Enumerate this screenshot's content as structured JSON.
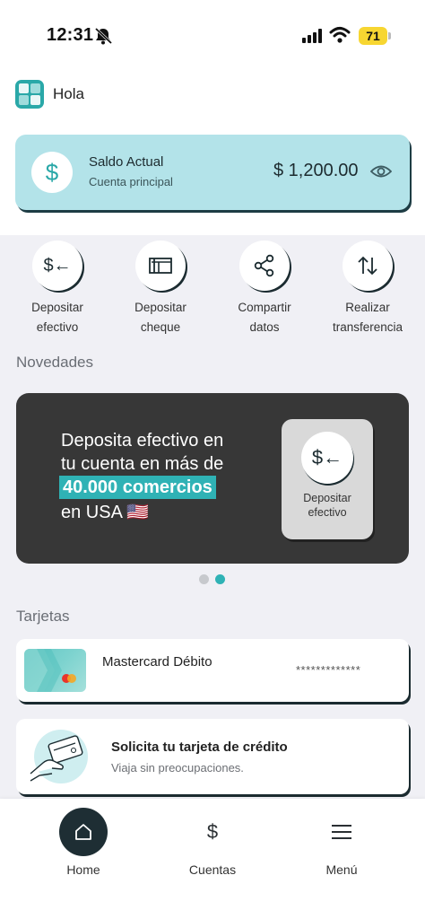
{
  "status_bar": {
    "time": "12:31",
    "battery": "71"
  },
  "header": {
    "greeting": "Hola"
  },
  "balance": {
    "title": "Saldo Actual",
    "subtitle": "Cuenta principal",
    "amount": "$ 1,200.00",
    "icon_symbol": "$"
  },
  "quick_actions": [
    {
      "line1": "Depositar",
      "line2": "efectivo",
      "icon": "deposit-cash-icon",
      "glyph": "$←"
    },
    {
      "line1": "Depositar",
      "line2": "cheque",
      "icon": "check-icon",
      "glyph": ""
    },
    {
      "line1": "Compartir",
      "line2": "datos",
      "icon": "share-icon",
      "glyph": ""
    },
    {
      "line1": "Realizar",
      "line2": "transferencia",
      "icon": "transfer-icon",
      "glyph": ""
    }
  ],
  "news": {
    "title": "Novedades",
    "promo": {
      "line1": "Deposita efectivo en",
      "line2": "tu cuenta en más de",
      "highlight": "40.000 comercios",
      "line4": "en USA 🇺🇸",
      "card_glyph": "$←",
      "card_line1": "Depositar",
      "card_line2": "efectivo"
    },
    "pagination": {
      "total": 2,
      "active": 2
    }
  },
  "cards": {
    "title": "Tarjetas",
    "debit": {
      "name": "Mastercard Débito",
      "number": "*************"
    },
    "credit_request": {
      "title": "Solicita tu tarjeta de crédito",
      "subtitle": "Viaja sin preocupaciones."
    }
  },
  "bottom_nav": [
    {
      "label": "Home",
      "icon": "home-icon",
      "active": true
    },
    {
      "label": "Cuentas",
      "icon": "dollar-icon",
      "glyph": "$",
      "active": false
    },
    {
      "label": "Menú",
      "icon": "menu-icon",
      "active": false
    }
  ],
  "colors": {
    "accent": "#2fb2b5",
    "balance_bg": "#b3e3e9",
    "dark": "#1e2e34",
    "promo_bg": "#373737"
  }
}
